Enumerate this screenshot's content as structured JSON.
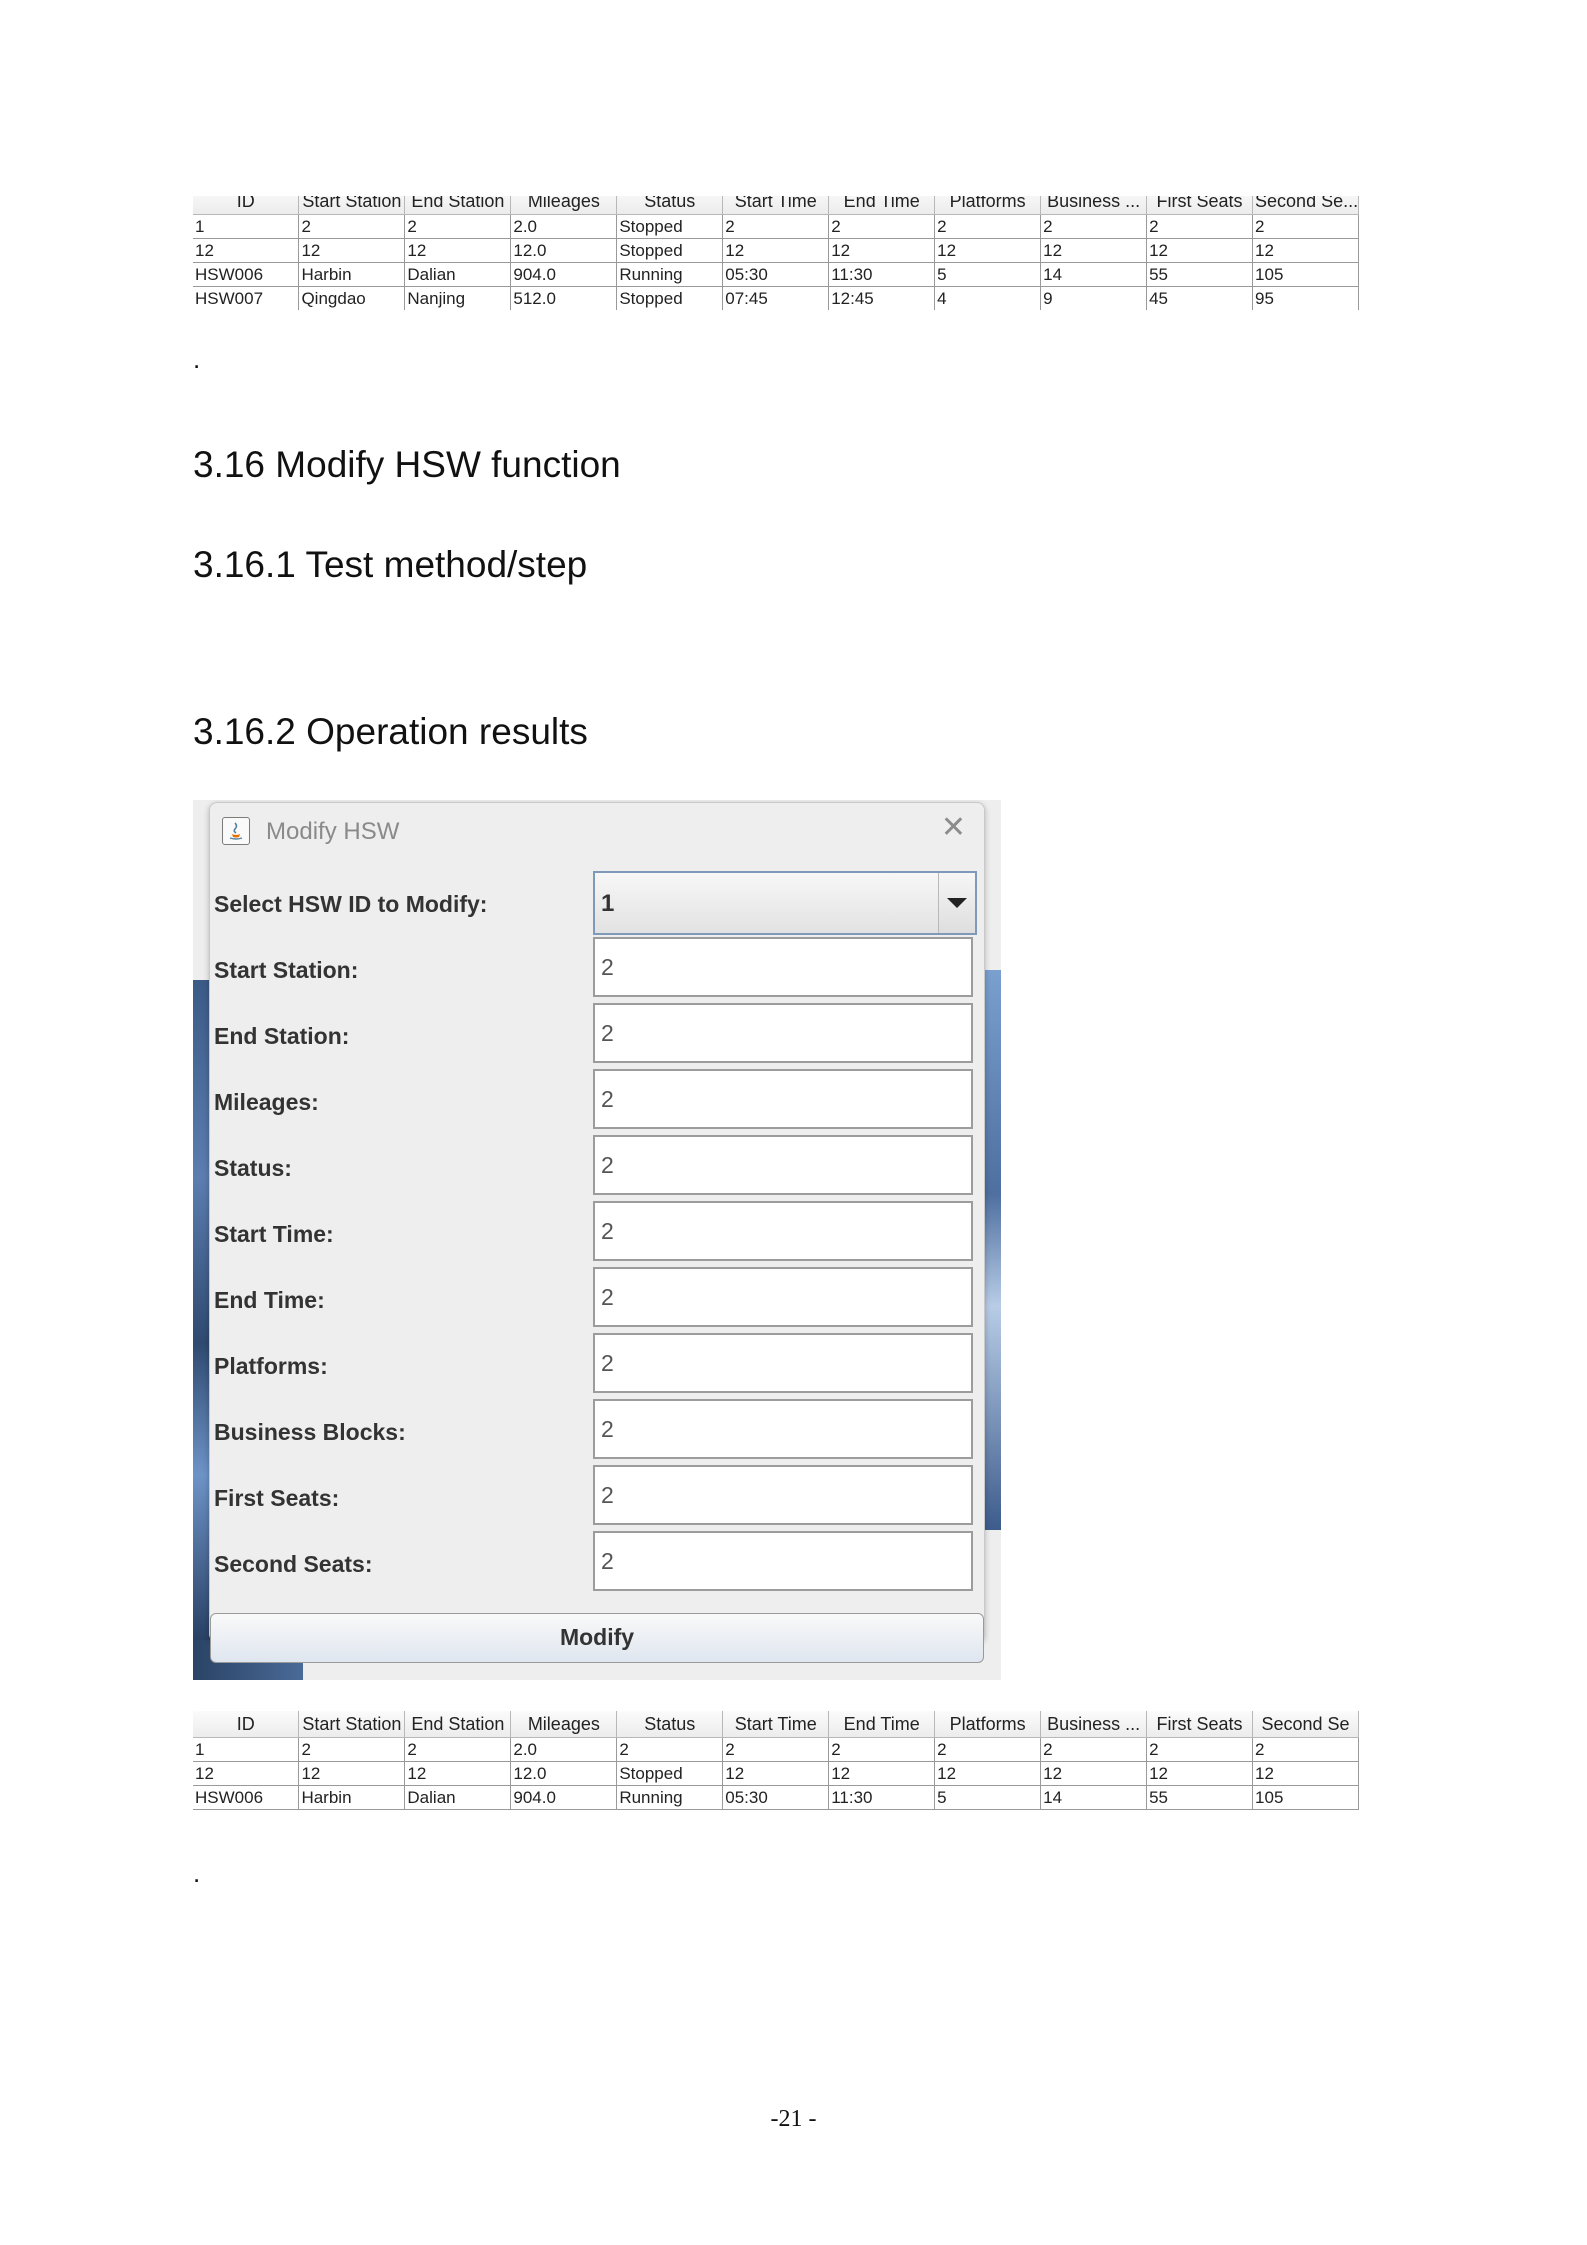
{
  "table_columns": [
    "ID",
    "Start Station",
    "End Station",
    "Mileages",
    "Status",
    "Start Time",
    "End Time",
    "Platforms",
    "Business ...",
    "First Seats",
    "Second Se..."
  ],
  "table1": {
    "rows": [
      [
        "1",
        "2",
        "2",
        "2.0",
        "Stopped",
        "2",
        "2",
        "2",
        "2",
        "2",
        "2"
      ],
      [
        "12",
        "12",
        "12",
        "12.0",
        "Stopped",
        "12",
        "12",
        "12",
        "12",
        "12",
        "12"
      ],
      [
        "HSW006",
        "Harbin",
        "Dalian",
        "904.0",
        "Running",
        "05:30",
        "11:30",
        "5",
        "14",
        "55",
        "105"
      ],
      [
        "HSW007",
        "Qingdao",
        "Nanjing",
        "512.0",
        "Stopped",
        "07:45",
        "12:45",
        "4",
        "9",
        "45",
        "95"
      ]
    ]
  },
  "dot1": ".",
  "headings": {
    "h1": "3.16 Modify HSW function",
    "h2": "3.16.1 Test method/step",
    "h3": "3.16.2 Operation results"
  },
  "dialog": {
    "title": "Modify HSW",
    "close_glyph": "✕",
    "select_label": "Select HSW ID to Modify:",
    "select_value": "1",
    "fields": [
      {
        "label": "Start Station:",
        "value": "2"
      },
      {
        "label": "End Station:",
        "value": "2"
      },
      {
        "label": "Mileages:",
        "value": "2"
      },
      {
        "label": "Status:",
        "value": "2"
      },
      {
        "label": "Start Time:",
        "value": "2"
      },
      {
        "label": "End Time:",
        "value": "2"
      },
      {
        "label": "Platforms:",
        "value": "2"
      },
      {
        "label": "Business Blocks:",
        "value": "2"
      },
      {
        "label": "First Seats:",
        "value": "2"
      },
      {
        "label": "Second Seats:",
        "value": "2"
      }
    ],
    "button_label": "Modify"
  },
  "table2": {
    "columns": [
      "ID",
      "Start Station",
      "End Station",
      "Mileages",
      "Status",
      "Start Time",
      "End Time",
      "Platforms",
      "Business ...",
      "First Seats",
      "Second Se"
    ],
    "rows": [
      [
        "1",
        "2",
        "2",
        "2.0",
        "2",
        "2",
        "2",
        "2",
        "2",
        "2",
        "2"
      ],
      [
        "12",
        "12",
        "12",
        "12.0",
        "Stopped",
        "12",
        "12",
        "12",
        "12",
        "12",
        "12"
      ],
      [
        "HSW006",
        "Harbin",
        "Dalian",
        "904.0",
        "Running",
        "05:30",
        "11:30",
        "5",
        "14",
        "55",
        "105"
      ]
    ]
  },
  "dot2": ".",
  "page_number": "-21 -"
}
